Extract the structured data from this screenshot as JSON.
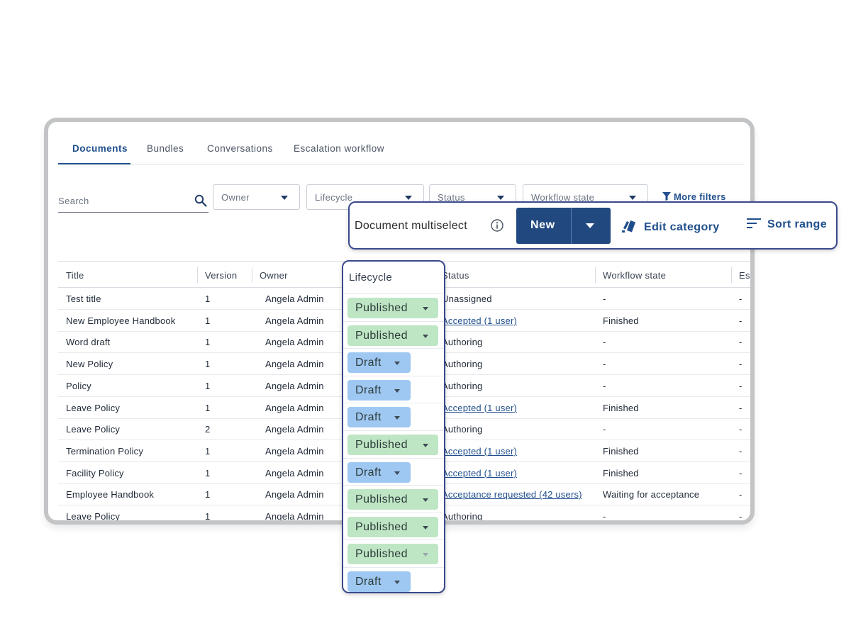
{
  "tabs": [
    {
      "label": "Documents",
      "active": true
    },
    {
      "label": "Bundles",
      "active": false
    },
    {
      "label": "Conversations",
      "active": false
    },
    {
      "label": "Escalation workflow",
      "active": false
    }
  ],
  "search": {
    "placeholder": "Search",
    "icon": "search-icon"
  },
  "filters": [
    {
      "label": "Owner"
    },
    {
      "label": "Lifecycle"
    },
    {
      "label": "Status"
    },
    {
      "label": "Workflow state"
    }
  ],
  "more_filters": {
    "label": "More filters",
    "icon": "funnel-icon"
  },
  "table": {
    "columns": [
      "Title",
      "Version",
      "Owner",
      "Status",
      "Workflow state",
      "Es"
    ],
    "rows": [
      {
        "title": "Test title",
        "version": "1",
        "owner": "Angela Admin",
        "status": "Unassigned",
        "status_link": false,
        "workflow": "-",
        "extra": "-"
      },
      {
        "title": "New Employee Handbook",
        "version": "1",
        "owner": "Angela Admin",
        "status": "Accepted (1 user)",
        "status_link": true,
        "workflow": "Finished",
        "extra": "-"
      },
      {
        "title": "Word draft",
        "version": "1",
        "owner": "Angela Admin",
        "status": "Authoring",
        "status_link": false,
        "workflow": "-",
        "extra": "-"
      },
      {
        "title": "New Policy",
        "version": "1",
        "owner": "Angela Admin",
        "status": "Authoring",
        "status_link": false,
        "workflow": "-",
        "extra": "-"
      },
      {
        "title": "Policy",
        "version": "1",
        "owner": "Angela Admin",
        "status": "Authoring",
        "status_link": false,
        "workflow": "-",
        "extra": "-"
      },
      {
        "title": "Leave Policy",
        "version": "1",
        "owner": "Angela Admin",
        "status": "Accepted (1 user)",
        "status_link": true,
        "workflow": "Finished",
        "extra": "-"
      },
      {
        "title": "Leave Policy",
        "version": "2",
        "owner": "Angela Admin",
        "status": "Authoring",
        "status_link": false,
        "workflow": "-",
        "extra": "-"
      },
      {
        "title": "Termination Policy",
        "version": "1",
        "owner": "Angela Admin",
        "status": "Accepted (1 user)",
        "status_link": true,
        "workflow": "Finished",
        "extra": "-"
      },
      {
        "title": "Facility Policy",
        "version": "1",
        "owner": "Angela Admin",
        "status": "Accepted (1 user)",
        "status_link": true,
        "workflow": "Finished",
        "extra": "-"
      },
      {
        "title": "Employee Handbook",
        "version": "1",
        "owner": "Angela Admin",
        "status": "Acceptance requested (42 users)",
        "status_link": true,
        "workflow": "Waiting for acceptance",
        "extra": "-"
      },
      {
        "title": "Leave Policy",
        "version": "1",
        "owner": "Angela Admin",
        "status": "Authoring",
        "status_link": false,
        "workflow": "-",
        "extra": "-"
      }
    ]
  },
  "toolbar": {
    "title": "Document multiselect",
    "info_icon": "info-icon",
    "new_label": "New",
    "edit_category_label": "Edit category",
    "edit_category_icon": "tag-icon",
    "sort_range_label": "Sort range",
    "sort_range_icon": "sort-icon"
  },
  "lifecycle": {
    "title": "Lifecycle",
    "items": [
      {
        "label": "Published",
        "kind": "published"
      },
      {
        "label": "Published",
        "kind": "published"
      },
      {
        "label": "Draft",
        "kind": "draft"
      },
      {
        "label": "Draft",
        "kind": "draft"
      },
      {
        "label": "Draft",
        "kind": "draft"
      },
      {
        "label": "Published",
        "kind": "published"
      },
      {
        "label": "Draft",
        "kind": "draft"
      },
      {
        "label": "Published",
        "kind": "published"
      },
      {
        "label": "Published",
        "kind": "published"
      },
      {
        "label": "Published",
        "kind": "published"
      },
      {
        "label": "Draft",
        "kind": "draft"
      }
    ]
  },
  "colors": {
    "accent": "#1f4e8c",
    "primary_button": "#21497f",
    "published_chip": "#bfe6c4",
    "draft_chip": "#9ec8f1",
    "overlay_border": "#3b4a8c"
  }
}
